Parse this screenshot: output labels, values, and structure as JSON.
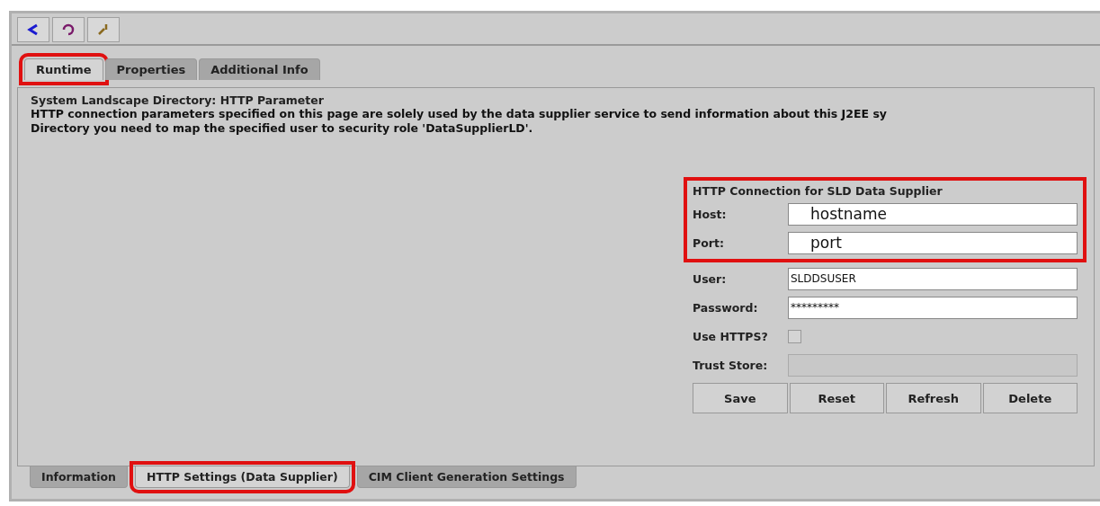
{
  "toolbar": {
    "buttons": [
      {
        "kind": "back"
      },
      {
        "kind": "refresh"
      },
      {
        "kind": "tools"
      }
    ]
  },
  "top_tabs": [
    {
      "label": "Runtime",
      "selected": true,
      "highlighted": true
    },
    {
      "label": "Properties",
      "selected": false,
      "highlighted": false
    },
    {
      "label": "Additional Info",
      "selected": false,
      "highlighted": false
    }
  ],
  "group": {
    "title": "System Landscape Directory: HTTP Parameter",
    "description": [
      "HTTP connection parameters specified on this page are solely used by the data supplier service to send information about this J2EE sy",
      "Directory you need to map the specified user to security role 'DataSupplierLD'."
    ],
    "connection": {
      "title": "HTTP Connection for SLD Data Supplier",
      "highlighted": true,
      "fields": [
        {
          "kind": "annotated",
          "label": "Host:",
          "value": "hostname"
        },
        {
          "kind": "annotated",
          "label": "Port:",
          "value": "port"
        },
        {
          "kind": "text",
          "label": "User:",
          "value": "SLDDSUSER"
        },
        {
          "kind": "text",
          "label": "Password:",
          "value": "*********"
        },
        {
          "kind": "checkbox",
          "label": "Use HTTPS?",
          "checked": false
        },
        {
          "kind": "disabled",
          "label": "Trust Store:"
        }
      ],
      "buttons": [
        "Save",
        "Reset",
        "Refresh",
        "Delete"
      ]
    }
  },
  "bottom_tabs": [
    {
      "label": "Information",
      "selected": false,
      "highlighted": false
    },
    {
      "label": "HTTP Settings (Data Supplier)",
      "selected": true,
      "highlighted": true
    },
    {
      "label": "CIM Client Generation Settings",
      "selected": false,
      "highlighted": false
    }
  ]
}
